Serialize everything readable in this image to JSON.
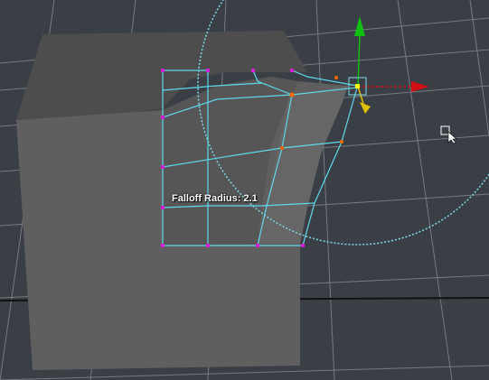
{
  "viewport": {
    "background_color": "#3a3f46",
    "grid_color": "#8a8f96",
    "cube_color_front": "#5f5f5f",
    "cube_color_top": "#4d4d4d",
    "wireframe_color": "#5fd7e8",
    "vertex_color": "#d21fd2",
    "selected_vertex_color": "#ff6a00",
    "falloff_circle_color": "#7fd8e6"
  },
  "falloff": {
    "label": "Falloff Radius:",
    "value": "2.1"
  },
  "manipulator": {
    "x_axis_color": "#d01010",
    "y_axis_color": "#10c010",
    "z_axis_color": "#e0c000",
    "center_color": "#ffff00"
  },
  "cursor": {
    "icon": "move-pointer-icon"
  }
}
